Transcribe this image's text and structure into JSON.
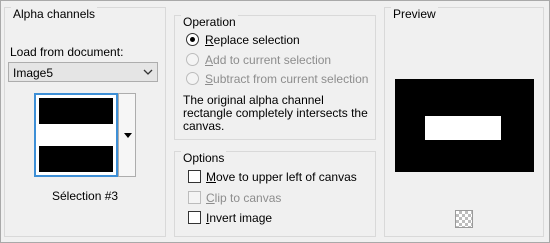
{
  "alpha_channels": {
    "title": "Alpha channels",
    "load_label": "Load from document:",
    "document_value": "Image5",
    "selection_caption": "Sélection #3"
  },
  "operation": {
    "title": "Operation",
    "options": [
      {
        "label": "Replace selection",
        "selected": true,
        "enabled": true
      },
      {
        "label": "Add to current selection",
        "selected": false,
        "enabled": false
      },
      {
        "label": "Subtract from current selection",
        "selected": false,
        "enabled": false
      }
    ],
    "description": "The original alpha channel rectangle completely intersects the canvas."
  },
  "options_group": {
    "title": "Options",
    "items": [
      {
        "label": "Move to upper left of canvas",
        "checked": false,
        "enabled": true
      },
      {
        "label": "Clip to canvas",
        "checked": false,
        "enabled": false
      },
      {
        "label": "Invert image",
        "checked": false,
        "enabled": true
      }
    ]
  },
  "preview": {
    "title": "Preview"
  }
}
